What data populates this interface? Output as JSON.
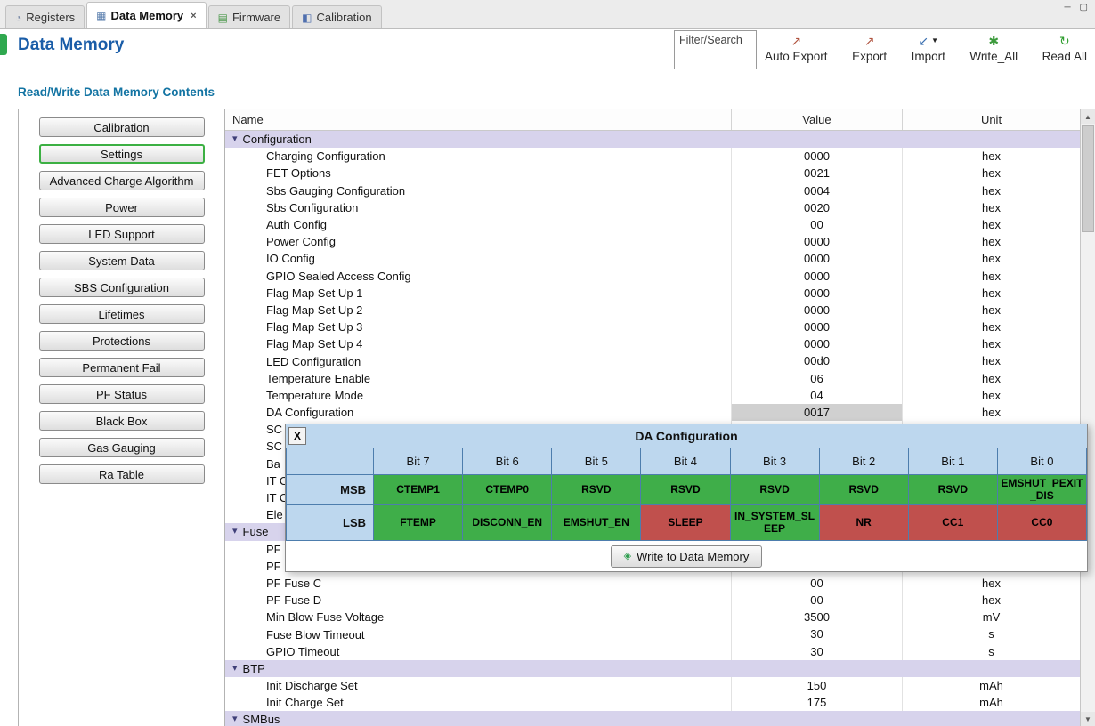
{
  "colors": {
    "title": "#1a5da8",
    "section_title": "#1374a3",
    "section_row_bg": "#d7d3ec",
    "selected_value_bg": "#d0d0d0",
    "selected_green": "#3cb043"
  },
  "icons": {
    "minimize": "─",
    "maximize": "▢",
    "dropdown": "▼",
    "collapse": "▾",
    "scroll_up": "▲",
    "scroll_down": "▼",
    "tab_close": "×",
    "write_bullet": "◈"
  },
  "tabs": [
    {
      "label": "Registers",
      "active": false,
      "closable": false,
      "icon": {
        "name": "registers-tab-icon",
        "glyph": "◔",
        "color": "#7a8aa8"
      }
    },
    {
      "label": "Data Memory",
      "active": true,
      "closable": true,
      "icon": {
        "name": "data-memory-tab-icon",
        "glyph": "▦",
        "color": "#5b7fae"
      }
    },
    {
      "label": "Firmware",
      "active": false,
      "closable": false,
      "icon": {
        "name": "firmware-tab-icon",
        "glyph": "▤",
        "color": "#4f9a4f"
      }
    },
    {
      "label": "Calibration",
      "active": false,
      "closable": false,
      "icon": {
        "name": "calibration-tab-icon",
        "glyph": "◧",
        "color": "#4f6fae"
      }
    }
  ],
  "header": {
    "title": "Data Memory",
    "filter_placeholder": "Filter/Search",
    "buttons": [
      {
        "label": "Auto Export",
        "icon_name": "auto-export-icon",
        "glyph": "↗",
        "color": "#b0533f",
        "dropdown": false
      },
      {
        "label": "Export",
        "icon_name": "export-icon",
        "glyph": "↗",
        "color": "#b0533f",
        "dropdown": false
      },
      {
        "label": "Import",
        "icon_name": "import-icon",
        "glyph": "↙",
        "color": "#3a6fb0",
        "dropdown": true
      },
      {
        "label": "Write_All",
        "icon_name": "write-all-icon",
        "glyph": "✱",
        "color": "#3c9a3c",
        "dropdown": false
      },
      {
        "label": "Read All",
        "icon_name": "read-all-icon",
        "glyph": "↻",
        "color": "#2f9e2f",
        "dropdown": false
      }
    ]
  },
  "section_title": "Read/Write Data Memory Contents",
  "sidebar": {
    "selected_index": 1,
    "items": [
      "Calibration",
      "Settings",
      "Advanced Charge Algorithm",
      "Power",
      "LED Support",
      "System Data",
      "SBS Configuration",
      "Lifetimes",
      "Protections",
      "Permanent Fail",
      "PF Status",
      "Black Box",
      "Gas Gauging",
      "Ra Table"
    ]
  },
  "table": {
    "columns": [
      "Name",
      "Value",
      "Unit"
    ],
    "rows": [
      {
        "type": "section",
        "name": "Configuration"
      },
      {
        "type": "data",
        "name": "Charging Configuration",
        "value": "0000",
        "unit": "hex"
      },
      {
        "type": "data",
        "name": "FET Options",
        "value": "0021",
        "unit": "hex"
      },
      {
        "type": "data",
        "name": "Sbs Gauging Configuration",
        "value": "0004",
        "unit": "hex"
      },
      {
        "type": "data",
        "name": "Sbs Configuration",
        "value": "0020",
        "unit": "hex"
      },
      {
        "type": "data",
        "name": "Auth Config",
        "value": "00",
        "unit": "hex"
      },
      {
        "type": "data",
        "name": "Power Config",
        "value": "0000",
        "unit": "hex"
      },
      {
        "type": "data",
        "name": "IO Config",
        "value": "0000",
        "unit": "hex"
      },
      {
        "type": "data",
        "name": "GPIO Sealed Access Config",
        "value": "0000",
        "unit": "hex"
      },
      {
        "type": "data",
        "name": "Flag Map Set Up 1",
        "value": "0000",
        "unit": "hex"
      },
      {
        "type": "data",
        "name": "Flag Map Set Up 2",
        "value": "0000",
        "unit": "hex"
      },
      {
        "type": "data",
        "name": "Flag Map Set Up 3",
        "value": "0000",
        "unit": "hex"
      },
      {
        "type": "data",
        "name": "Flag Map Set Up 4",
        "value": "0000",
        "unit": "hex"
      },
      {
        "type": "data",
        "name": "LED Configuration",
        "value": "00d0",
        "unit": "hex"
      },
      {
        "type": "data",
        "name": "Temperature Enable",
        "value": "06",
        "unit": "hex"
      },
      {
        "type": "data",
        "name": "Temperature Mode",
        "value": "04",
        "unit": "hex"
      },
      {
        "type": "data",
        "name": "DA Configuration",
        "value": "0017",
        "unit": "hex",
        "selected": true
      },
      {
        "type": "data",
        "name": "SC",
        "value": "",
        "unit": ""
      },
      {
        "type": "data",
        "name": "SC",
        "value": "",
        "unit": ""
      },
      {
        "type": "data",
        "name": "Ba",
        "value": "",
        "unit": ""
      },
      {
        "type": "data",
        "name": "IT C",
        "value": "",
        "unit": ""
      },
      {
        "type": "data",
        "name": "IT C",
        "value": "",
        "unit": ""
      },
      {
        "type": "data",
        "name": "Ele",
        "value": "",
        "unit": ""
      },
      {
        "type": "section",
        "name": "Fuse"
      },
      {
        "type": "data",
        "name": "PF",
        "value": "",
        "unit": ""
      },
      {
        "type": "data",
        "name": "PF",
        "value": "",
        "unit": ""
      },
      {
        "type": "data",
        "name": "PF Fuse C",
        "value": "00",
        "unit": "hex"
      },
      {
        "type": "data",
        "name": "PF Fuse D",
        "value": "00",
        "unit": "hex"
      },
      {
        "type": "data",
        "name": "Min Blow Fuse Voltage",
        "value": "3500",
        "unit": "mV"
      },
      {
        "type": "data",
        "name": "Fuse Blow Timeout",
        "value": "30",
        "unit": "s"
      },
      {
        "type": "data",
        "name": "GPIO Timeout",
        "value": "30",
        "unit": "s"
      },
      {
        "type": "section",
        "name": "BTP"
      },
      {
        "type": "data",
        "name": "Init Discharge Set",
        "value": "150",
        "unit": "mAh"
      },
      {
        "type": "data",
        "name": "Init Charge Set",
        "value": "175",
        "unit": "mAh"
      },
      {
        "type": "section",
        "name": "SMBus"
      }
    ]
  },
  "popup": {
    "title": "DA Configuration",
    "close_label": "X",
    "write_button_label": "Write to Data Memory",
    "colors": {
      "header": "#bdd7ee",
      "bit_set": "#c0504d",
      "bit_clear": "#3fae49"
    },
    "column_headers": [
      "Bit 7",
      "Bit 6",
      "Bit 5",
      "Bit 4",
      "Bit 3",
      "Bit 2",
      "Bit 1",
      "Bit 0"
    ],
    "bit_rows": [
      {
        "label": "MSB",
        "cells": [
          {
            "text": "CTEMP1",
            "set": false
          },
          {
            "text": "CTEMP0",
            "set": false
          },
          {
            "text": "RSVD",
            "set": false
          },
          {
            "text": "RSVD",
            "set": false
          },
          {
            "text": "RSVD",
            "set": false
          },
          {
            "text": "RSVD",
            "set": false
          },
          {
            "text": "RSVD",
            "set": false
          },
          {
            "text": "EMSHUT_PEXIT_DIS",
            "set": false
          }
        ]
      },
      {
        "label": "LSB",
        "cells": [
          {
            "text": "FTEMP",
            "set": false
          },
          {
            "text": "DISCONN_EN",
            "set": false
          },
          {
            "text": "EMSHUT_EN",
            "set": false
          },
          {
            "text": "SLEEP",
            "set": true
          },
          {
            "text": "IN_SYSTEM_SLEEP",
            "set": false
          },
          {
            "text": "NR",
            "set": true
          },
          {
            "text": "CC1",
            "set": true
          },
          {
            "text": "CC0",
            "set": true
          }
        ]
      }
    ]
  }
}
